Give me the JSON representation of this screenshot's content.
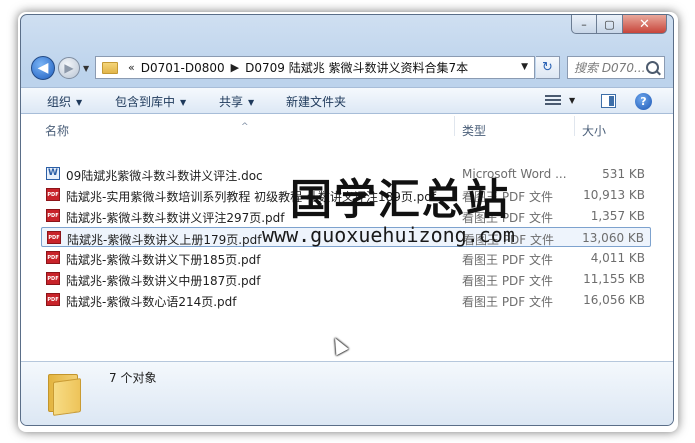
{
  "window": {
    "controls": {
      "minimize": "–",
      "maximize": "▢",
      "close": "✕"
    }
  },
  "nav": {
    "back_glyph": "◀",
    "forward_glyph": "▶",
    "breadcrumb_prefix": "«",
    "breadcrumb": [
      "D0701-D0800",
      "D0709 陆斌兆 紫微斗数讲义资料合集7本"
    ],
    "breadcrumb_sep": "▶",
    "refresh_glyph": "↻",
    "search_placeholder": "搜索 D070..."
  },
  "toolbar": {
    "organize": "组织",
    "include_in_library": "包含到库中",
    "share": "共享",
    "new_folder": "新建文件夹",
    "help": "?"
  },
  "columns": {
    "name": "名称",
    "type": "类型",
    "size": "大小"
  },
  "files": [
    {
      "name": "09陆斌兆紫微斗数斗数讲义评注.doc",
      "type": "Microsoft Word ...",
      "size": "531 KB",
      "icon": "word-doc-icon"
    },
    {
      "name": "陆斌兆-实用紫微斗数培训系列教程 初级教程 斗数讲义评注189页.pdf",
      "type": "看图王 PDF 文件",
      "size": "10,913 KB",
      "icon": "pdf-icon"
    },
    {
      "name": "陆斌兆-紫微斗数斗数讲义评注297页.pdf",
      "type": "看图王 PDF 文件",
      "size": "1,357 KB",
      "icon": "pdf-icon"
    },
    {
      "name": "陆斌兆-紫微斗数讲义上册179页.pdf",
      "type": "看图王 PDF 文件",
      "size": "13,060 KB",
      "icon": "pdf-icon",
      "selected": true
    },
    {
      "name": "陆斌兆-紫微斗数讲义下册185页.pdf",
      "type": "看图王 PDF 文件",
      "size": "4,011 KB",
      "icon": "pdf-icon"
    },
    {
      "name": "陆斌兆-紫微斗数讲义中册187页.pdf",
      "type": "看图王 PDF 文件",
      "size": "11,155 KB",
      "icon": "pdf-icon"
    },
    {
      "name": "陆斌兆-紫微斗数心语214页.pdf",
      "type": "看图王 PDF 文件",
      "size": "16,056 KB",
      "icon": "pdf-icon"
    }
  ],
  "watermark": {
    "title": "国学汇总站",
    "url": "www.guoxuehuizong.com"
  },
  "status": {
    "count_text": "7 个对象"
  },
  "colors": {
    "selection_border": "#7da2ce",
    "selection_fill": "#eef4fc",
    "pdf_red": "#c8232a"
  }
}
